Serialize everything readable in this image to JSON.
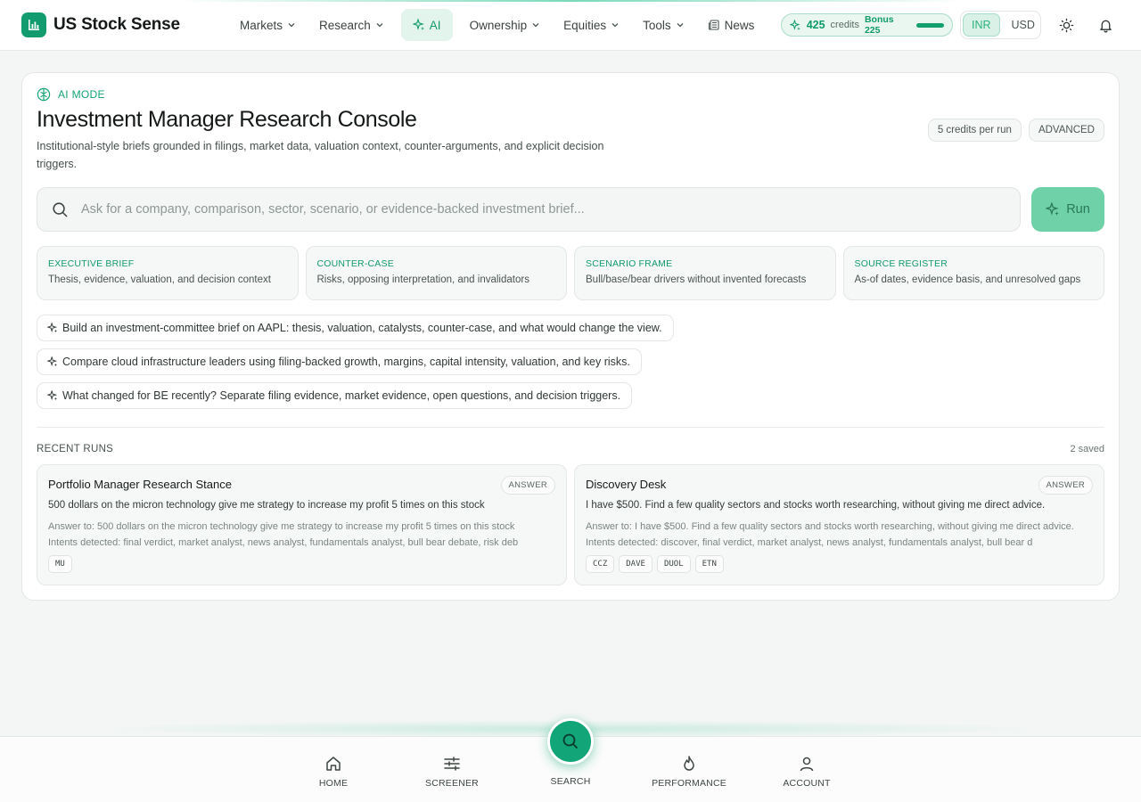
{
  "brand": {
    "name": "US Stock Sense",
    "accent": "#119b6e"
  },
  "nav": {
    "markets": "Markets",
    "research": "Research",
    "ai": "AI",
    "ownership": "Ownership",
    "equities": "Equities",
    "tools": "Tools",
    "news": "News"
  },
  "credits": {
    "amount": "425",
    "word": "credits",
    "bonus": "Bonus 225"
  },
  "currency": {
    "options": [
      "INR",
      "USD"
    ],
    "selected": "INR"
  },
  "header": {
    "mode": "AI MODE",
    "title": "Investment Manager Research Console",
    "subtitle": "Institutional-style briefs grounded in filings, market data, valuation context, counter-arguments, and explicit decision triggers.",
    "tags": [
      "5 credits per run",
      "ADVANCED"
    ]
  },
  "search": {
    "placeholder": "Ask for a company, comparison, sector, scenario, or evidence-backed investment brief...",
    "value": "",
    "run_label": "Run"
  },
  "features": [
    {
      "title": "EXECUTIVE BRIEF",
      "desc": "Thesis, evidence, valuation, and decision context"
    },
    {
      "title": "COUNTER-CASE",
      "desc": "Risks, opposing interpretation, and invalidators"
    },
    {
      "title": "SCENARIO FRAME",
      "desc": "Bull/base/bear drivers without invented forecasts"
    },
    {
      "title": "SOURCE REGISTER",
      "desc": "As-of dates, evidence basis, and unresolved gaps"
    }
  ],
  "prompts": [
    "Build an investment-committee brief on AAPL: thesis, valuation, catalysts, counter-case, and what would change the view.",
    "Compare cloud infrastructure leaders using filing-backed growth, margins, capital intensity, valuation, and key risks.",
    "What changed for BE recently? Separate filing evidence, market evidence, open questions, and decision triggers."
  ],
  "recent": {
    "label": "RECENT RUNS",
    "saved": "2 saved",
    "runs": [
      {
        "title": "Portfolio Manager Research Stance",
        "badge": "ANSWER",
        "query": "500 dollars on the micron technology give me strategy to increase my profit 5 times on this stock",
        "answer": "Answer to: 500 dollars on the micron technology give me strategy to increase my profit 5 times on this stock",
        "intents": "Intents detected: final verdict, market analyst, news analyst, fundamentals analyst, bull bear debate, risk deb",
        "tickers": [
          "MU"
        ]
      },
      {
        "title": "Discovery Desk",
        "badge": "ANSWER",
        "query": "I have $500. Find a few quality sectors and stocks worth researching, without giving me direct advice.",
        "answer": "Answer to: I have $500. Find a few quality sectors and stocks worth researching, without giving me direct advice.",
        "intents": "Intents detected: discover, final verdict, market analyst, news analyst, fundamentals analyst, bull bear d",
        "tickers": [
          "CCZ",
          "DAVE",
          "DUOL",
          "ETN"
        ]
      }
    ]
  },
  "bottom_nav": {
    "home": "HOME",
    "screener": "SCREENER",
    "search": "SEARCH",
    "performance": "PERFORMANCE",
    "account": "ACCOUNT"
  }
}
